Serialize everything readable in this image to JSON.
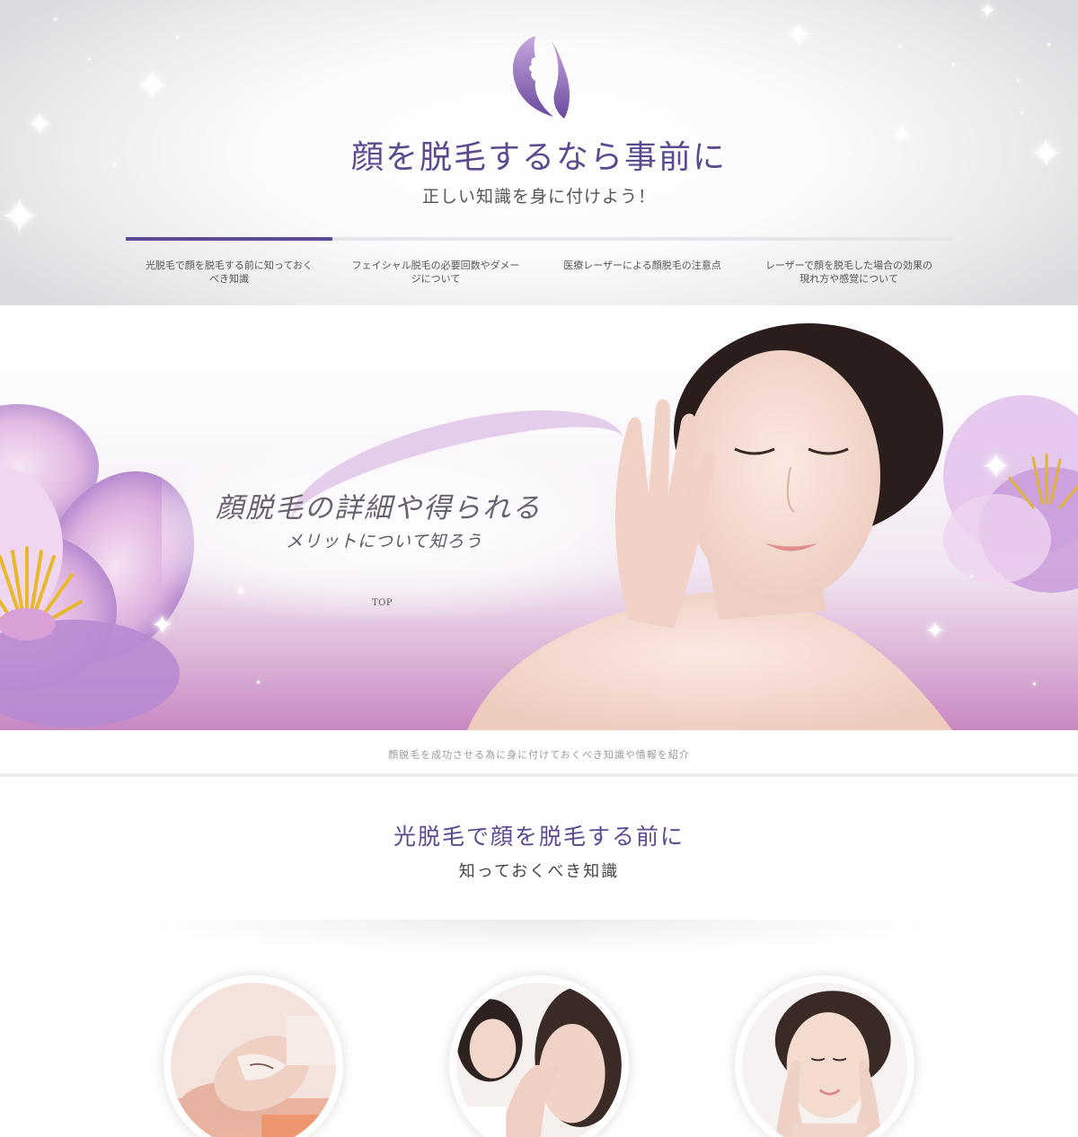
{
  "header": {
    "title": "顔を脱毛するなら事前に",
    "subtitle": "正しい知識を身に付けよう！"
  },
  "nav": {
    "items": [
      {
        "label": "光脱毛で顔を脱毛する前に知っておくべき知識"
      },
      {
        "label": "フェイシャル脱毛の必要回数やダメージについて"
      },
      {
        "label": "医療レーザーによる顔脱毛の注意点"
      },
      {
        "label": "レーザーで顔を脱毛した場合の効果の現れ方や感覚について"
      }
    ],
    "active_index": 0
  },
  "hero": {
    "title": "顔脱毛の詳細や得られる",
    "subtitle": "メリットについて知ろう",
    "top_link": "TOP"
  },
  "tagline": "顔脱毛を成功させる為に身に付けておくべき知識や情報を紹介",
  "section": {
    "title": "光脱毛で顔を脱毛する前に",
    "subtitle": "知っておくべき知識"
  },
  "colors": {
    "accent": "#5c4a99",
    "title": "#5b4a8f"
  }
}
